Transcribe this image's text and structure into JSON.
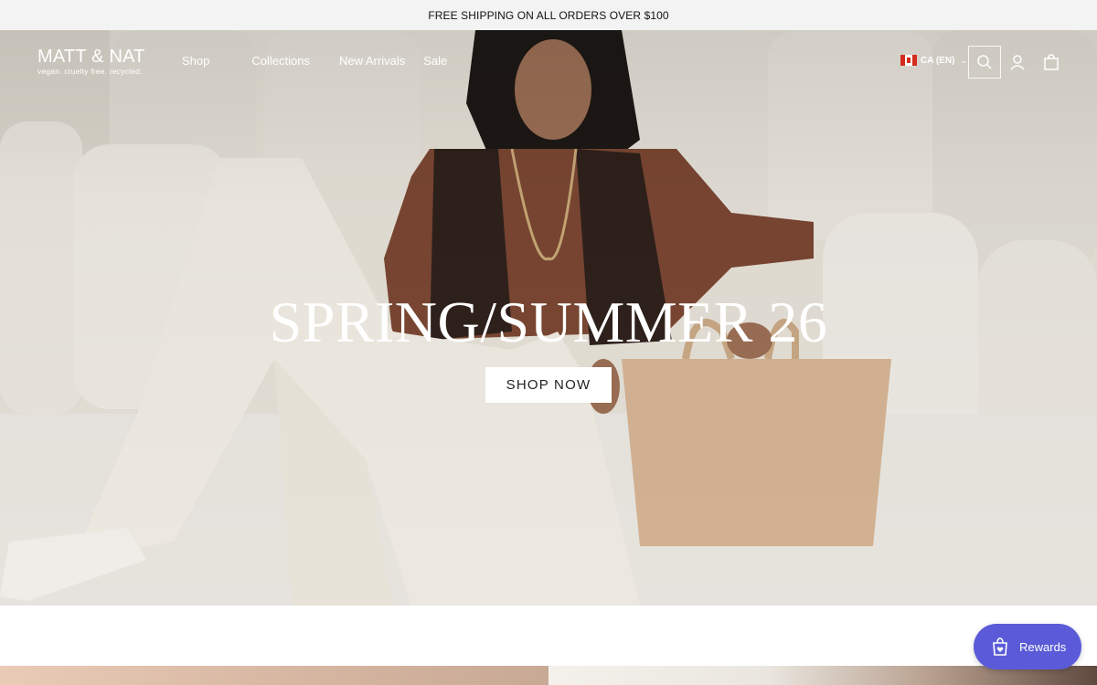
{
  "announcement": {
    "text": "FREE SHIPPING ON ALL ORDERS OVER $100"
  },
  "brand": {
    "name": "MATT & NAT",
    "tagline": "vegan. cruelty free. recycled."
  },
  "nav": {
    "items": [
      {
        "label": "Shop"
      },
      {
        "label": "Collections"
      },
      {
        "label": "New Arrivals"
      },
      {
        "label": "Sale"
      }
    ]
  },
  "locale": {
    "label": "CA (EN)",
    "flag_icon": "canada-flag-icon"
  },
  "header_icons": [
    "search-icon",
    "account-icon",
    "cart-icon"
  ],
  "hero": {
    "title": "SPRING/SUMMER 26",
    "cta_label": "SHOP NOW"
  },
  "rewards": {
    "label": "Rewards",
    "icon": "bag-heart-icon",
    "color": "#5b5bd9"
  }
}
